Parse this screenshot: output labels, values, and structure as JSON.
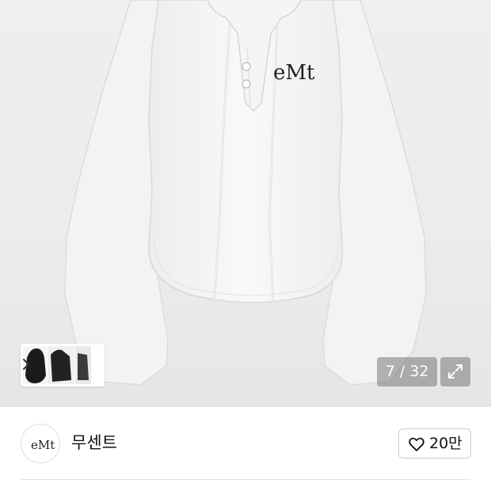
{
  "gallery": {
    "counter": "7 / 32",
    "expand_icon": "expand-arrows-icon",
    "thumbnail_next_icon": "chevron-right-icon"
  },
  "product_image": {
    "logo_text": "eMt"
  },
  "seller": {
    "avatar_logo_text": "eMt",
    "name": "무센트"
  },
  "like": {
    "icon": "heart-outline-icon",
    "count": "20만"
  },
  "colors": {
    "hero_bg": "#ececec",
    "garment": "#f7f7f7",
    "overlay": "#7b7b7b"
  }
}
